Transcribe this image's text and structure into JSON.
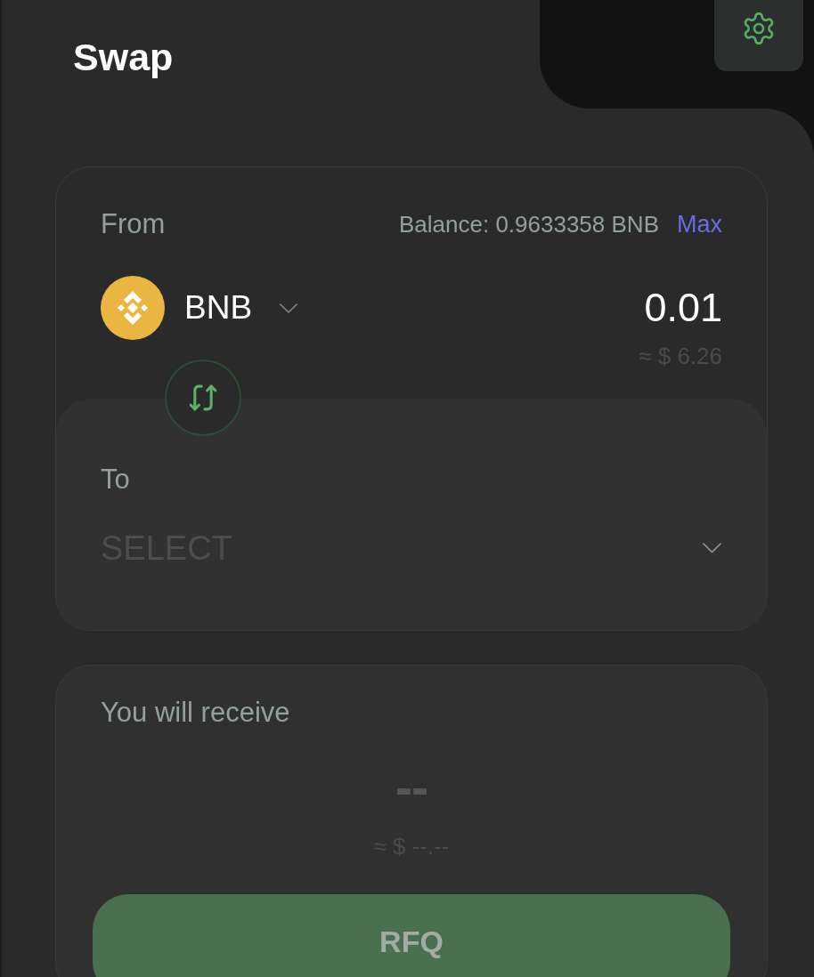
{
  "header": {
    "title": "Swap"
  },
  "from": {
    "label": "From",
    "balance": "Balance: 0.9633358 BNB",
    "max": "Max",
    "token": "BNB",
    "amount": "0.01",
    "usd": "≈ $ 6.26"
  },
  "to": {
    "label": "To",
    "token": {
      "placeholder": "SELECT"
    }
  },
  "receive": {
    "label": "You will receive",
    "amount": "--",
    "usd": "≈ $ --.--"
  },
  "action": {
    "label": "RFQ",
    "disabled": true
  }
}
